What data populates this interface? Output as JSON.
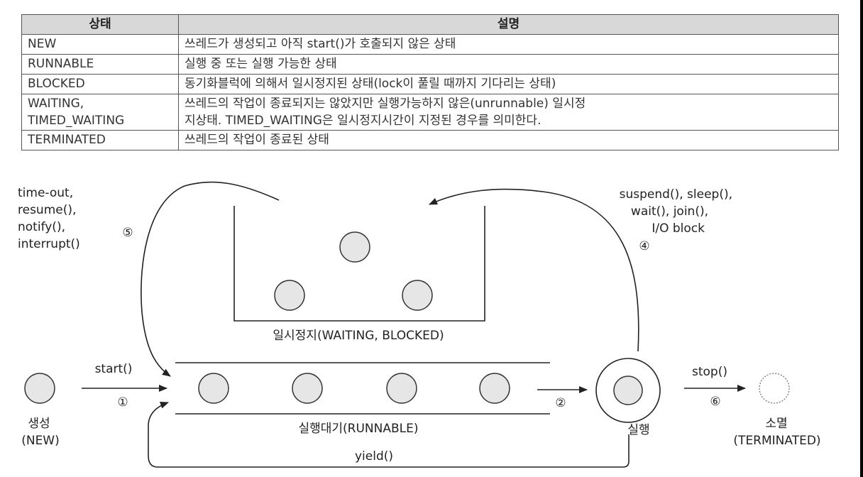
{
  "table": {
    "headers": {
      "state": "상태",
      "description": "설명"
    },
    "rows": [
      {
        "state": "NEW",
        "description": [
          "쓰레드가 생성되고 아직 start()가 호출되지 않은 상태"
        ]
      },
      {
        "state": "RUNNABLE",
        "description": [
          "실행 중 또는 실행 가능한 상태"
        ]
      },
      {
        "state": "BLOCKED",
        "description": [
          "동기화블럭에 의해서 일시정지된 상태(lock이 풀릴 때까지 기다리는 상태)"
        ]
      },
      {
        "state": [
          "WAITING,",
          "TIMED_WAITING"
        ],
        "description": [
          "쓰레드의 작업이 종료되지는 않았지만 실행가능하지 않은(unrunnable) 일시정",
          "지상태. TIMED_WAITING은 일시정지시간이 지정된 경우를 의미한다."
        ]
      },
      {
        "state": "TERMINATED",
        "description": [
          "쓰레드의 작업이 종료된 상태"
        ]
      }
    ]
  },
  "diagram": {
    "new_label": "생성",
    "new_sub": "(NEW)",
    "runnable_label": "실행대기(RUNNABLE)",
    "waiting_label": "일시정지(WAITING, BLOCKED)",
    "running_label": "실행",
    "terminated_label": "소멸",
    "terminated_sub": "(TERMINATED)",
    "start_label": "start()",
    "stop_label": "stop()",
    "yield_label": "yield()",
    "resume_lines": [
      "time-out,",
      "resume(),",
      "notify(),",
      "interrupt()"
    ],
    "suspend_lines": [
      "suspend(), sleep(),",
      "wait(), join(),",
      "I/O block"
    ],
    "step1": "①",
    "step2": "②",
    "step4": "④",
    "step5": "⑤",
    "step6": "⑥"
  },
  "colors": {
    "circle_fill": "#e6e6e6",
    "stroke": "#222222",
    "header_fill": "#d8d8d8"
  }
}
